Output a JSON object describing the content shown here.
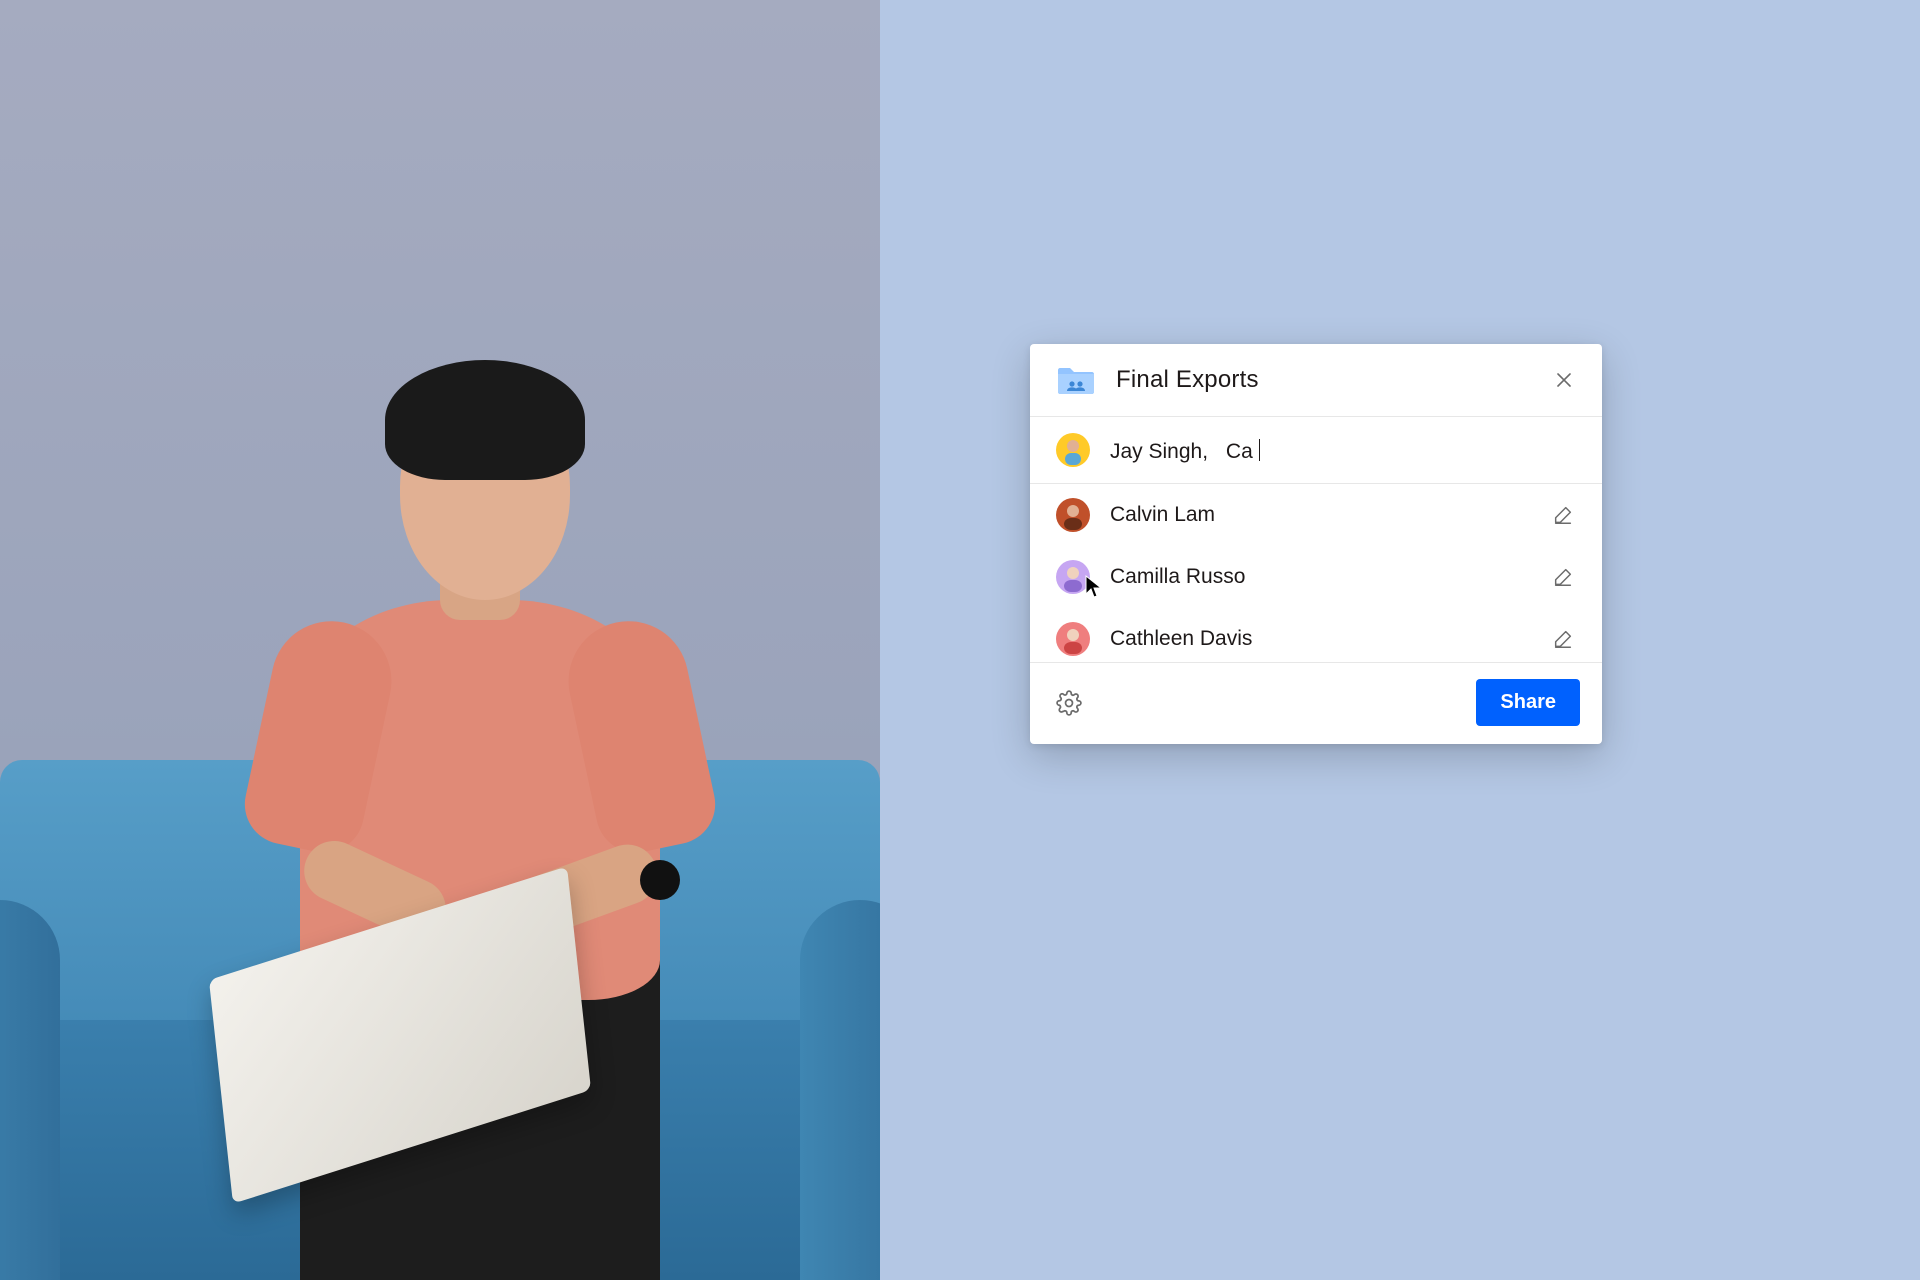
{
  "share_dialog": {
    "folder_name": "Final Exports",
    "input": {
      "entered_name": "Jay Singh,",
      "typing_fragment": "Ca"
    },
    "suggestions": [
      {
        "name": "Calvin Lam",
        "permission_icon": "edit",
        "avatar_color": "#c0502a"
      },
      {
        "name": "Camilla Russo",
        "permission_icon": "edit",
        "avatar_color": "#c6a6f2"
      },
      {
        "name": "Cathleen Davis",
        "permission_icon": "edit",
        "avatar_color": "#ef7e7e"
      }
    ],
    "share_button_label": "Share"
  }
}
